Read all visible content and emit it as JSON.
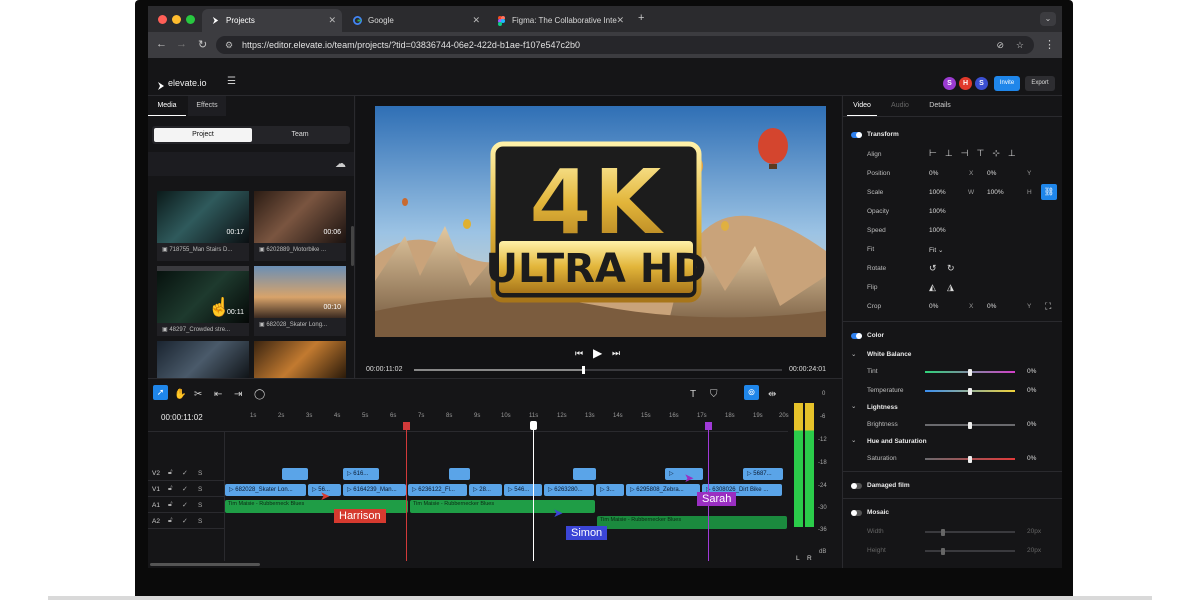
{
  "browser": {
    "tabs": [
      {
        "label": "Projects",
        "icon": "elevate-logo-icon",
        "active": true
      },
      {
        "label": "Google",
        "icon": "google-icon",
        "active": false
      },
      {
        "label": "Figma: The Collaborative Inte",
        "icon": "figma-icon",
        "active": false
      }
    ],
    "new_tab": "+",
    "url": "https://editor.elevate.io/team/projects/?tid=03836744-06e2-422d-b1ae-f107e547c2b0"
  },
  "app": {
    "brand": "elevate.io",
    "avatars": [
      {
        "letter": "S",
        "color": "#9b3bd1"
      },
      {
        "letter": "H",
        "color": "#e0392b"
      },
      {
        "letter": "S",
        "color": "#3b4fd1"
      }
    ],
    "invite_label": "Invite",
    "export_label": "Export"
  },
  "left_panel": {
    "tabs": [
      "Media",
      "Effects"
    ],
    "segments": [
      "Project",
      "Team"
    ],
    "media": [
      {
        "caption": "718755_Man Stairs D...",
        "duration": "00:17"
      },
      {
        "caption": "6202889_Motorbike ...",
        "duration": "00:06"
      },
      {
        "caption": "48297_Crowded stre...",
        "duration": "00:11"
      },
      {
        "caption": "682028_Skater Long...",
        "duration": "00:10"
      },
      {
        "caption": "",
        "duration": ""
      },
      {
        "caption": "",
        "duration": ""
      }
    ]
  },
  "preview": {
    "badge_top": "4K",
    "badge_bottom": "ULTRA HD",
    "current_time": "00:00:11:02",
    "total_time": "00:00:24:01",
    "progress": 0.46
  },
  "right_panel": {
    "tabs": [
      "Video",
      "Audio",
      "Details"
    ],
    "transform": {
      "title": "Transform",
      "rows": [
        {
          "label": "Align"
        },
        {
          "label": "Position",
          "v1": "0%",
          "l1": "X",
          "v2": "0%",
          "l2": "Y"
        },
        {
          "label": "Scale",
          "v1": "100%",
          "l1": "W",
          "v2": "100%",
          "l2": "H"
        },
        {
          "label": "Opacity",
          "v1": "100%"
        },
        {
          "label": "Speed",
          "v1": "100%"
        },
        {
          "label": "Fit",
          "v1": "Fit"
        },
        {
          "label": "Rotate"
        },
        {
          "label": "Flip"
        },
        {
          "label": "Crop",
          "v1": "0%",
          "l1": "X",
          "v2": "0%",
          "l2": "Y"
        }
      ]
    },
    "color": {
      "title": "Color",
      "white_balance": "White Balance",
      "tint": {
        "label": "Tint",
        "value": "0%",
        "level": 0.5
      },
      "temperature": {
        "label": "Temperature",
        "value": "0%",
        "level": 0.5
      },
      "lightness": "Lightness",
      "brightness": {
        "label": "Brightness",
        "value": "0%",
        "level": 0.5
      },
      "hue_saturation": "Hue and Saturation",
      "saturation": {
        "label": "Saturation",
        "value": "0%",
        "level": 0.5
      }
    },
    "damaged_film": "Damaged film",
    "mosaic": {
      "title": "Mosaic",
      "width": {
        "label": "Width",
        "value": "20px"
      },
      "height": {
        "label": "Height",
        "value": "20px"
      }
    }
  },
  "timeline": {
    "timecode": "00:00:11:02",
    "ticks": [
      "1s",
      "2s",
      "3s",
      "4s",
      "5s",
      "6s",
      "7s",
      "8s",
      "9s",
      "10s",
      "11s",
      "12s",
      "13s",
      "14s",
      "15s",
      "16s",
      "17s",
      "18s",
      "19s",
      "20s"
    ],
    "tracks": [
      "V2",
      "V1",
      "A1",
      "A2"
    ],
    "track_flag": "S",
    "v2_clips": [
      "",
      "616...",
      "",
      "",
      "",
      "",
      "5687..."
    ],
    "v1_clips": [
      "682028_Skater Lon...",
      "56...",
      "6164239_Man...",
      "6236122_Fl...",
      "28...",
      "546...",
      "6263280...",
      "3...",
      "6295808_Zebra...",
      "6308026_Dirt Bike ..."
    ],
    "a1_clips": [
      "Tim Maisie - Rubberneck Blues",
      "Tim Maisie - Rubbernecker Blues"
    ],
    "a2_clips": [
      "Tim Maisie - Rubbernecker Blues"
    ],
    "collaborators": [
      {
        "name": "Harrison",
        "color": "#d63a2f"
      },
      {
        "name": "Simon",
        "color": "#3b45d6"
      },
      {
        "name": "Sarah",
        "color": "#9a2fc2"
      }
    ],
    "meter_scale": [
      "0",
      "-6",
      "-12",
      "-18",
      "-24",
      "-30",
      "-36",
      "dB"
    ],
    "meter_channels": [
      "L",
      "R"
    ]
  }
}
